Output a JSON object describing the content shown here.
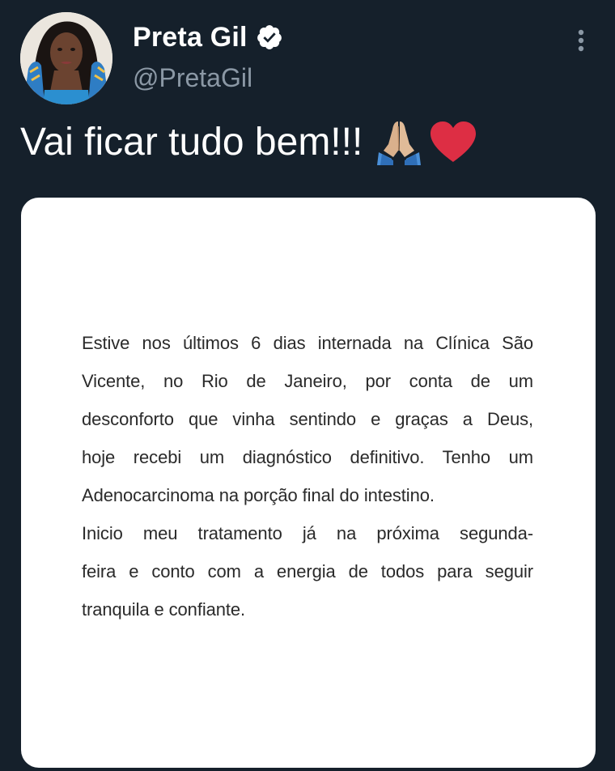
{
  "author": {
    "display_name": "Preta Gil",
    "handle": "@PretaGil",
    "verified": true,
    "avatar_icon": "profile-photo"
  },
  "tweet": {
    "text": "Vai ficar tudo bem!!!",
    "emojis": [
      "folded-hands-icon",
      "red-heart-icon"
    ]
  },
  "media": {
    "lines": [
      "Estive nos últimos 6 dias internada na Clínica São",
      "Vicente, no Rio de Janeiro, por conta de um",
      "desconforto que vinha sentindo e graças a Deus,",
      "hoje recebi um diagnóstico definitivo. Tenho um",
      "Adenocarcinoma na porção final do intestino.",
      "Inicio meu tratamento já na próxima segunda-",
      "feira e conto com a energia de todos para seguir",
      "tranquila e confiante."
    ]
  },
  "colors": {
    "background": "#15202b",
    "text": "#ffffff",
    "secondary_text": "#8b98a5",
    "media_background": "#ffffff",
    "heart": "#dd2e44"
  }
}
